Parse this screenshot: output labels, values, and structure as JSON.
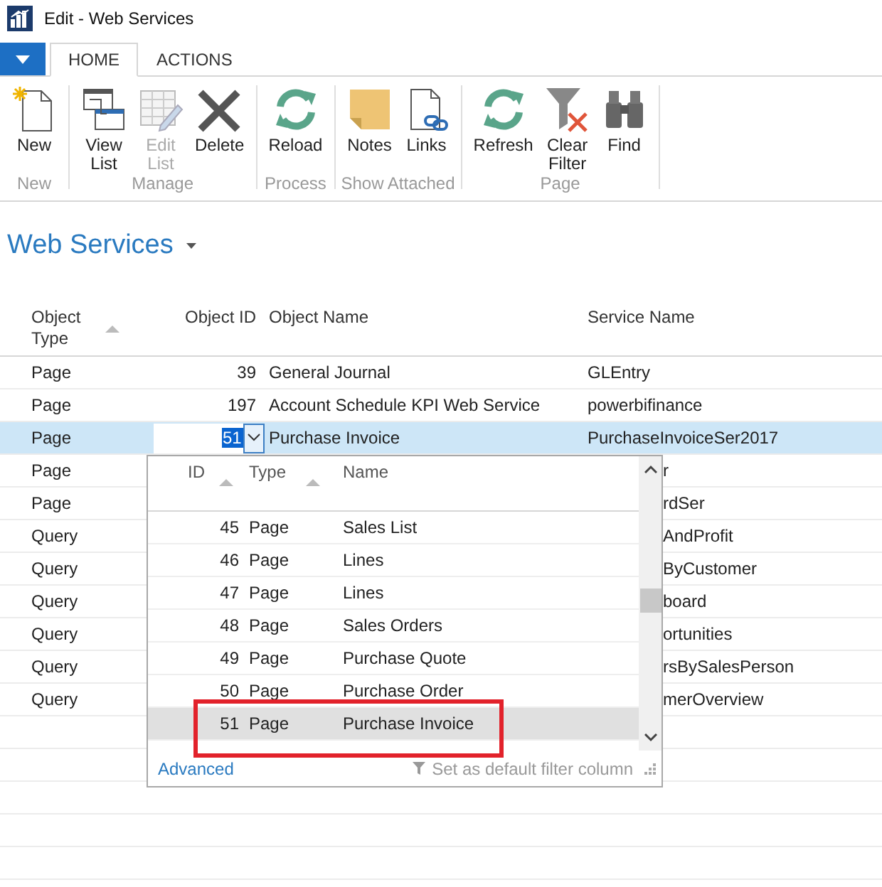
{
  "window": {
    "title": "Edit - Web Services"
  },
  "ribbon_tabs": [
    {
      "label": "HOME",
      "selected": true
    },
    {
      "label": "ACTIONS",
      "selected": false
    }
  ],
  "ribbon_groups": [
    {
      "label": "New",
      "buttons": [
        {
          "label": "New",
          "kind": "new",
          "disabled": false
        }
      ]
    },
    {
      "label": "Manage",
      "buttons": [
        {
          "label": "View List",
          "kind": "viewlist",
          "disabled": false
        },
        {
          "label": "Edit List",
          "kind": "editlist",
          "disabled": true
        },
        {
          "label": "Delete",
          "kind": "delete",
          "disabled": false
        }
      ]
    },
    {
      "label": "Process",
      "buttons": [
        {
          "label": "Reload",
          "kind": "reload",
          "disabled": false
        }
      ]
    },
    {
      "label": "Show Attached",
      "buttons": [
        {
          "label": "Notes",
          "kind": "notes",
          "disabled": false
        },
        {
          "label": "Links",
          "kind": "links",
          "disabled": false
        }
      ]
    },
    {
      "label": "Page",
      "buttons": [
        {
          "label": "Refresh",
          "kind": "reload",
          "disabled": false
        },
        {
          "label": "Clear Filter",
          "kind": "clearfilter",
          "disabled": false
        },
        {
          "label": "Find",
          "kind": "find",
          "disabled": false
        }
      ]
    }
  ],
  "page_title": "Web Services",
  "columns": [
    "Object Type",
    "Object ID",
    "Object Name",
    "Service Name"
  ],
  "rows": [
    {
      "object_type": "Page",
      "object_id": "39",
      "object_name": "General Journal",
      "service_name": "GLEntry",
      "selected": false
    },
    {
      "object_type": "Page",
      "object_id": "197",
      "object_name": "Account Schedule KPI Web Service",
      "service_name": "powerbifinance",
      "selected": false
    },
    {
      "object_type": "Page",
      "object_id": "51",
      "object_name": "Purchase Invoice",
      "service_name": "PurchaseInvoiceSer2017",
      "selected": true
    }
  ],
  "rows_behind_lookup": [
    {
      "object_type": "Page",
      "service_name": "r"
    },
    {
      "object_type": "Page",
      "service_name": "rdSer"
    },
    {
      "object_type": "Query",
      "service_name": "AndProfit"
    },
    {
      "object_type": "Query",
      "service_name": "ByCustomer"
    },
    {
      "object_type": "Query",
      "service_name": "board"
    },
    {
      "object_type": "Query",
      "service_name": "ortunities"
    },
    {
      "object_type": "Query",
      "service_name": "rsBySalesPerson"
    },
    {
      "object_type": "Query",
      "service_name": "merOverview"
    }
  ],
  "lookup": {
    "columns": [
      "ID",
      "Type",
      "Name"
    ],
    "rows": [
      {
        "id": "45",
        "type": "Page",
        "name": "Sales List",
        "selected": false
      },
      {
        "id": "46",
        "type": "Page",
        "name": "Lines",
        "selected": false
      },
      {
        "id": "47",
        "type": "Page",
        "name": "Lines",
        "selected": false
      },
      {
        "id": "48",
        "type": "Page",
        "name": "Sales Orders",
        "selected": false
      },
      {
        "id": "49",
        "type": "Page",
        "name": "Purchase Quote",
        "selected": false
      },
      {
        "id": "50",
        "type": "Page",
        "name": "Purchase Order",
        "selected": false
      },
      {
        "id": "51",
        "type": "Page",
        "name": "Purchase Invoice",
        "selected": true
      }
    ],
    "advanced_link": "Advanced",
    "filter_hint": "Set as default filter column"
  }
}
